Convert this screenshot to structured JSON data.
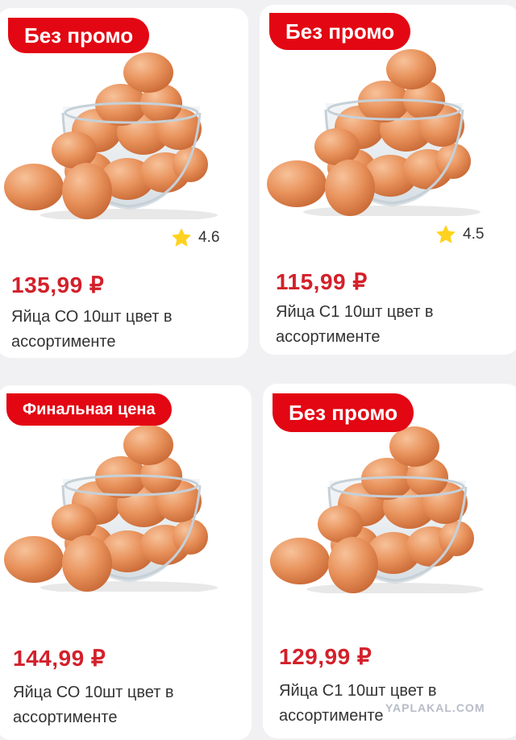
{
  "products": [
    {
      "badge": "Без промо",
      "rating": "4.6",
      "price": "135,99 ₽",
      "title": "Яйца СО 10шт цвет в ассортименте"
    },
    {
      "badge": "Без промо",
      "rating": "4.5",
      "price": "115,99 ₽",
      "title": "Яйца С1 10шт цвет в ассортименте"
    },
    {
      "badge": "Финальная цена",
      "price": "144,99 ₽",
      "title": "Яйца СО 10шт цвет в ассортименте"
    },
    {
      "badge": "Без промо",
      "price": "129,99 ₽",
      "title": "Яйца С1 10шт цвет в ассортименте"
    }
  ],
  "watermark": "YAPLAKAL.COM",
  "colors": {
    "badge": "#e30613",
    "price": "#d3202a",
    "star": "#ffd21f",
    "egg": "#e8915a"
  },
  "icons": {
    "rating": "star-icon",
    "product": "eggs-in-bowl-image"
  }
}
